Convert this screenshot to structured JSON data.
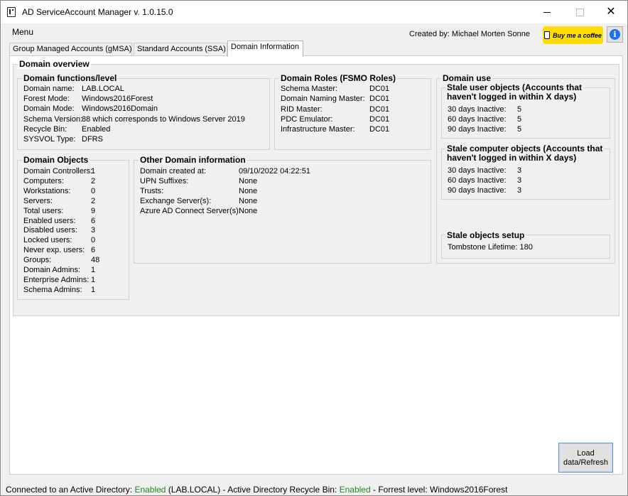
{
  "window": {
    "title": "AD ServiceAccount Manager v. 1.0.15.0",
    "controls": {
      "minimize": "—",
      "maximize": "☐",
      "close": "✕"
    }
  },
  "menu": {
    "label": "Menu"
  },
  "header": {
    "created_by": "Created by: Michael Morten Sonne",
    "coffee_label": "Buy me a coffee",
    "info_icon": "i"
  },
  "tabs": [
    {
      "label": "Group Managed Accounts (gMSA)",
      "active": false
    },
    {
      "label": "Standard Accounts (SSA)",
      "active": false
    },
    {
      "label": "Domain Information",
      "active": true
    }
  ],
  "overview": {
    "title": "Domain overview",
    "functions": {
      "title": "Domain functions/level",
      "rows": [
        {
          "label": "Domain name:",
          "value": "LAB.LOCAL"
        },
        {
          "label": "Forest Mode:",
          "value": "Windows2016Forest"
        },
        {
          "label": "Domain Mode:",
          "value": "Windows2016Domain"
        },
        {
          "label": "Schema Version:",
          "value": "88 which corresponds to Windows Server 2019"
        },
        {
          "label": "Recycle Bin:",
          "value": "Enabled"
        },
        {
          "label": "SYSVOL Type:",
          "value": "DFRS"
        }
      ]
    },
    "roles": {
      "title": "Domain Roles (FSMO Roles)",
      "rows": [
        {
          "label": "Schema Master:",
          "value": "DC01"
        },
        {
          "label": "Domain Naming Master:",
          "value": "DC01"
        },
        {
          "label": "RID Master:",
          "value": "DC01"
        },
        {
          "label": "PDC Emulator:",
          "value": "DC01"
        },
        {
          "label": "Infrastructure Master:",
          "value": "DC01"
        }
      ]
    },
    "objects": {
      "title": "Domain Objects",
      "rows": [
        {
          "label": "Domain Controllers:",
          "value": "1"
        },
        {
          "label": "Computers:",
          "value": "2"
        },
        {
          "label": "Workstations:",
          "value": "0"
        },
        {
          "label": "Servers:",
          "value": "2"
        },
        {
          "label": "Total users:",
          "value": "9"
        },
        {
          "label": "Enabled users:",
          "value": "6"
        },
        {
          "label": "Disabled users:",
          "value": "3"
        },
        {
          "label": "Locked users:",
          "value": "0"
        },
        {
          "label": "Never exp. users:",
          "value": "6"
        },
        {
          "label": "Groups:",
          "value": "48"
        },
        {
          "label": "Domain Admins:",
          "value": "1"
        },
        {
          "label": "Enterprise Admins:",
          "value": "1"
        },
        {
          "label": "Schema Admins:",
          "value": "1"
        }
      ]
    },
    "other": {
      "title": "Other Domain information",
      "rows": [
        {
          "label": "Domain created at:",
          "value": "09/10/2022 04:22:51"
        },
        {
          "label": "UPN Suffixes:",
          "value": "None"
        },
        {
          "label": "Trusts:",
          "value": "None"
        },
        {
          "label": "Exchange Server(s):",
          "value": "None"
        },
        {
          "label": "Azure AD Connect Server(s):",
          "value": "None"
        }
      ]
    },
    "use": {
      "title": "Domain use",
      "stale_users": {
        "title_line1": "Stale user objects (Accounts that",
        "title_line2": "haven't logged in within X days)",
        "rows": [
          {
            "label": "30 days Inactive:",
            "value": "5"
          },
          {
            "label": "60 days Inactive:",
            "value": "5"
          },
          {
            "label": "90 days Inactive:",
            "value": "5"
          }
        ]
      },
      "stale_computers": {
        "title_line1": "Stale computer objects (Accounts that",
        "title_line2": "haven't logged in within X days)",
        "rows": [
          {
            "label": "30 days Inactive:",
            "value": "3"
          },
          {
            "label": "60 days Inactive:",
            "value": "3"
          },
          {
            "label": "90 days Inactive:",
            "value": "3"
          }
        ]
      },
      "stale_setup": {
        "title": "Stale objects setup",
        "tombstone": "Tombstone Lifetime: 180"
      }
    }
  },
  "load_button": {
    "line1": "Load",
    "line2": "data/Refresh"
  },
  "statusbar": {
    "connected_label": "Connected to an Active Directory:",
    "connected_value": "Enabled",
    "domain": "(LAB.LOCAL)",
    "sep1": "-",
    "recycle_label": "Active Directory Recycle Bin:",
    "recycle_value": "Enabled",
    "sep2": "-",
    "forest_label": "Forrest level:",
    "forest_value": "Windows2016Forest"
  },
  "colors": {
    "enabled_green": "#1a8a1a",
    "coffee_yellow": "#ffdd00",
    "info_blue": "#1a73e8"
  }
}
